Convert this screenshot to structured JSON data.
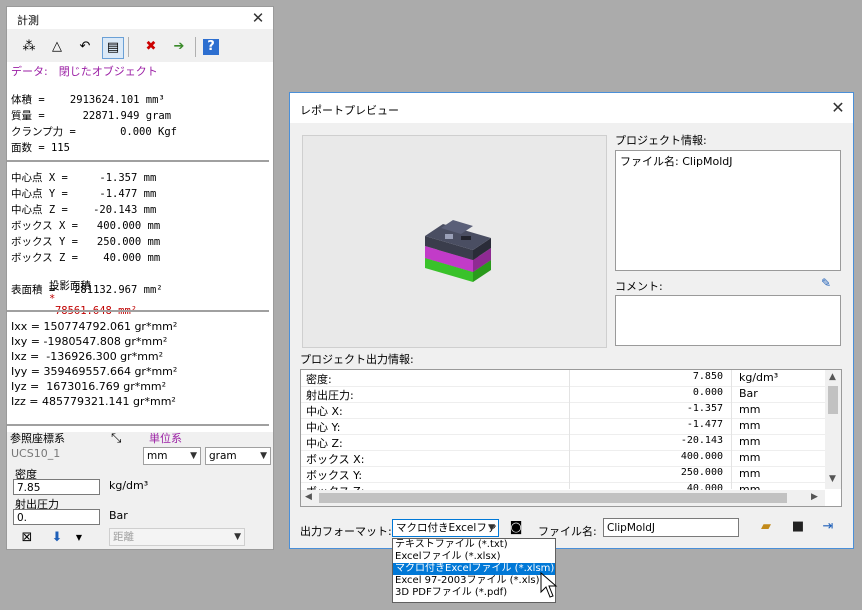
{
  "measure": {
    "title": "計測",
    "data_line": "データ:　閉じたオブジェクト",
    "props": [
      "体積 =    2913624.101 mm³",
      "質量 =      22871.949 gram",
      "クランプ力 =       0.000 Kgf",
      "面数 = 115"
    ],
    "geom": [
      "中心点 X =     -1.357 mm",
      "中心点 Y =     -1.477 mm",
      "中心点 Z =    -20.143 mm",
      "ボックス X =   400.000 mm",
      "ボックス Y =   250.000 mm",
      "ボックス Z =    40.000 mm"
    ],
    "proj_area_label": "投影面積",
    "proj_area_mark": "*",
    "proj_area_value": "78561.648 mm²",
    "surface_area": "表面積 =   281132.967 mm²",
    "inertia": [
      "Ixx = 150774792.061 gr*mm²",
      "Ixy = -1980547.808 gr*mm²",
      "Ixz =  -136926.300 gr*mm²",
      "Iyy = 359469557.664 gr*mm²",
      "Iyz =  1673016.769 gr*mm²",
      "Izz = 485779321.141 gr*mm²"
    ],
    "ref_coord_label": "参照座標系",
    "ref_coord_value": "UCS10_1",
    "unit_label": "単位系",
    "unit_length": "mm",
    "unit_mass": "gram",
    "density_label": "密度",
    "density_value": "7.85",
    "density_unit": "kg/dm³",
    "pressure_label": "射出圧力",
    "pressure_value": "0.",
    "pressure_unit": "Bar",
    "distance_select": "距離"
  },
  "preview": {
    "title": "レポートプレビュー",
    "object_info_label": "プロジェクト情報:",
    "object_info_text": "ファイル名: ClipMoldJ",
    "comment_label": "コメント:",
    "output_info_label": "プロジェクト出力情報:",
    "rows": [
      {
        "name": "密度:",
        "value": "7.850",
        "unit": "kg/dm³"
      },
      {
        "name": "射出圧力:",
        "value": "0.000",
        "unit": "Bar"
      },
      {
        "name": "中心 X:",
        "value": "-1.357",
        "unit": "mm"
      },
      {
        "name": "中心 Y:",
        "value": "-1.477",
        "unit": "mm"
      },
      {
        "name": "中心 Z:",
        "value": "-20.143",
        "unit": "mm"
      },
      {
        "name": "ボックス X:",
        "value": "400.000",
        "unit": "mm"
      },
      {
        "name": "ボックス Y:",
        "value": "250.000",
        "unit": "mm"
      },
      {
        "name": "ボックス Z:",
        "value": "40.000",
        "unit": "mm"
      }
    ],
    "format_label": "出力フォーマット:",
    "format_selected": "マクロ付きExcelファ",
    "filename_label": "ファイル名:",
    "filename_value": "ClipMoldJ",
    "format_options": [
      "テキストファイル (*.txt)",
      "Excelファイル (*.xlsx)",
      "マクロ付きExcelファイル (*.xlsm)",
      "Excel 97-2003ファイル (*.xls)",
      "3D PDFファイル (*.pdf)"
    ],
    "highlight_index": 2
  },
  "colors": {
    "purple": "#9b1fa5",
    "red": "#c00000",
    "highlight": "#0078d7"
  }
}
